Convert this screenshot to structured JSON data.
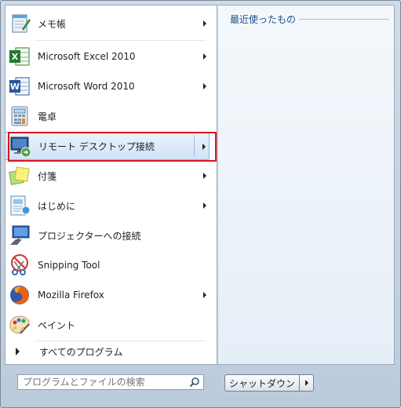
{
  "recent": {
    "title": "最近使ったもの"
  },
  "programs": [
    {
      "label": "メモ帳",
      "icon": "notepad-icon",
      "has_submenu": true
    },
    {
      "label": "Microsoft Excel 2010",
      "icon": "excel-icon",
      "has_submenu": true
    },
    {
      "label": "Microsoft Word 2010",
      "icon": "word-icon",
      "has_submenu": true
    },
    {
      "label": "電卓",
      "icon": "calculator-icon",
      "has_submenu": false
    },
    {
      "label": "リモート デスクトップ接続",
      "icon": "remote-desktop-icon",
      "has_submenu": true,
      "highlighted": true
    },
    {
      "label": "付箋",
      "icon": "sticky-notes-icon",
      "has_submenu": true
    },
    {
      "label": "はじめに",
      "icon": "getting-started-icon",
      "has_submenu": true
    },
    {
      "label": "プロジェクターへの接続",
      "icon": "projector-icon",
      "has_submenu": false
    },
    {
      "label": "Snipping Tool",
      "icon": "scissors-icon",
      "has_submenu": false
    },
    {
      "label": "Mozilla Firefox",
      "icon": "firefox-icon",
      "has_submenu": true
    },
    {
      "label": "ペイント",
      "icon": "paint-palette-icon",
      "has_submenu": false
    }
  ],
  "all_programs": {
    "label": "すべてのプログラム"
  },
  "search": {
    "placeholder": "プログラムとファイルの検索"
  },
  "shutdown": {
    "label": "シャットダウン"
  },
  "colors": {
    "highlight_border": "#e0131f",
    "recent_title": "#1b4c8a"
  }
}
